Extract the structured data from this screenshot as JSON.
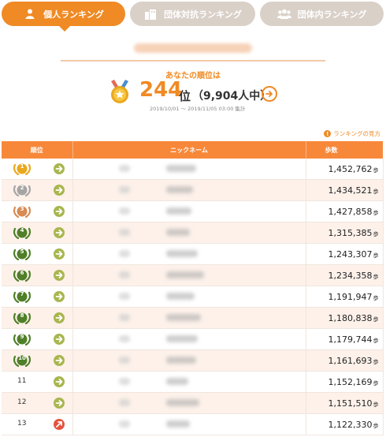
{
  "tabs": [
    {
      "label": "個人ランキング",
      "icon": "person-icon",
      "active": true
    },
    {
      "label": "団体対抗ランキング",
      "icon": "building-icon",
      "active": false
    },
    {
      "label": "団体内ランキング",
      "icon": "group-icon",
      "active": false
    }
  ],
  "my_rank": {
    "label": "あなたの順位は",
    "rank": "244",
    "unit": "位",
    "total": "（9,904人中）",
    "period": "2019/10/01 〜 2019/11/05 03:00 集計"
  },
  "help_link": "ランキングの見方",
  "table": {
    "headers": {
      "rank": "順位",
      "nickname": "ニックネーム",
      "steps": "歩数"
    },
    "step_unit": "歩",
    "rows": [
      {
        "rank": "1",
        "steps": "1,452,762",
        "badge": "gold",
        "trend": "same"
      },
      {
        "rank": "2",
        "steps": "1,434,521",
        "badge": "silver",
        "trend": "same"
      },
      {
        "rank": "3",
        "steps": "1,427,858",
        "badge": "bronze",
        "trend": "same"
      },
      {
        "rank": "4",
        "steps": "1,315,385",
        "badge": "green",
        "trend": "same"
      },
      {
        "rank": "5",
        "steps": "1,243,307",
        "badge": "green",
        "trend": "same"
      },
      {
        "rank": "6",
        "steps": "1,234,358",
        "badge": "green",
        "trend": "same"
      },
      {
        "rank": "7",
        "steps": "1,191,947",
        "badge": "green",
        "trend": "same"
      },
      {
        "rank": "8",
        "steps": "1,180,838",
        "badge": "green",
        "trend": "same"
      },
      {
        "rank": "9",
        "steps": "1,179,744",
        "badge": "green",
        "trend": "same"
      },
      {
        "rank": "10",
        "steps": "1,161,693",
        "badge": "green",
        "trend": "same"
      },
      {
        "rank": "11",
        "steps": "1,152,169",
        "badge": "none",
        "trend": "same"
      },
      {
        "rank": "12",
        "steps": "1,151,510",
        "badge": "none",
        "trend": "same"
      },
      {
        "rank": "13",
        "steps": "1,122,330",
        "badge": "none",
        "trend": "up"
      }
    ]
  },
  "colors": {
    "accent": "#f08a24",
    "tab_inactive": "#d9d0c8",
    "header": "#f7883a",
    "arrow_same": "#a9b64f",
    "arrow_up": "#e5533f",
    "gold": "#e9a81d",
    "silver": "#a5a5a5",
    "bronze": "#d88b52",
    "green_badge": "#4f7f28"
  }
}
